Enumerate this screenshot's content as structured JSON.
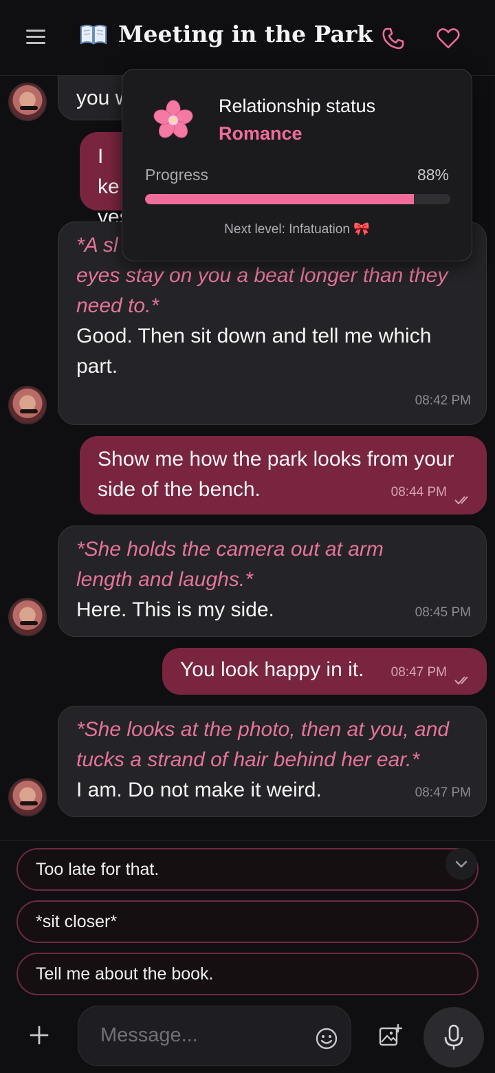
{
  "header": {
    "title": "Meeting in the Park",
    "icons": {
      "menu": "hamburger-icon",
      "book": "open-book-icon",
      "call": "phone-icon",
      "favorite": "heart-icon"
    }
  },
  "colors": {
    "accent": "#f06c9b",
    "outgoing_bubble": "#7a2540",
    "incoming_bubble": "#242428",
    "background": "#0f0f11"
  },
  "messages": [
    {
      "sender": "character",
      "action": "",
      "text": "you w",
      "time": ""
    },
    {
      "sender": "user",
      "text": "I ke yes",
      "time": ""
    },
    {
      "sender": "character",
      "action": "*A sl bench to make room, and her green eyes stay on you a beat longer than they need to.*",
      "text": "Good. Then sit down and tell me which part.",
      "time": "08:42 PM"
    },
    {
      "sender": "user",
      "text": "Show me how the park looks from your side of the bench.",
      "time": "08:44 PM",
      "read": true
    },
    {
      "sender": "character",
      "action": "*She holds the camera out at arm length and laughs.*",
      "text": "Here. This is my side.",
      "time": "08:45 PM"
    },
    {
      "sender": "user",
      "text": "You look happy in it.",
      "time": "08:47 PM",
      "read": true
    },
    {
      "sender": "character",
      "action": "*She looks at the photo, then at you, and tucks a strand of hair behind her ear.*",
      "text": "I am. Do not make it weird.",
      "time": "08:47 PM"
    }
  ],
  "popup": {
    "heading": "Relationship status",
    "status": "Romance",
    "progress_label": "Progress",
    "progress_text": "88%",
    "progress_value": 0.88,
    "next_level": "Next level: Infatuation 🎀",
    "icon": "cherry-blossom-icon"
  },
  "suggestions": [
    "Too late for that.",
    "*sit closer*",
    "Tell me about the book."
  ],
  "input": {
    "placeholder": "Message...",
    "value": ""
  }
}
